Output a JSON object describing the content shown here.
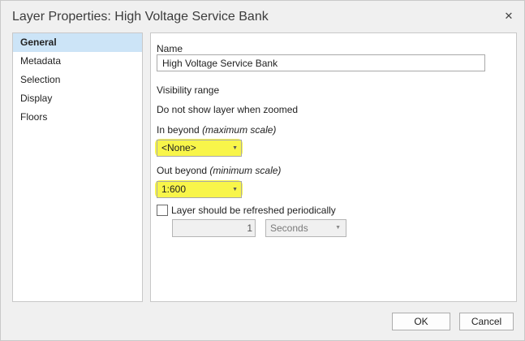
{
  "window": {
    "title": "Layer Properties: High Voltage Service Bank"
  },
  "sidebar": {
    "items": [
      {
        "label": "General",
        "selected": true
      },
      {
        "label": "Metadata",
        "selected": false
      },
      {
        "label": "Selection",
        "selected": false
      },
      {
        "label": "Display",
        "selected": false
      },
      {
        "label": "Floors",
        "selected": false
      }
    ]
  },
  "general": {
    "name_label": "Name",
    "name_value": "High Voltage Service Bank",
    "visibility_label": "Visibility range",
    "dont_show_label": "Do not show layer when zoomed",
    "in_beyond_label": "In beyond",
    "in_beyond_hint": "(maximum scale)",
    "in_beyond_value": "<None>",
    "out_beyond_label": "Out beyond",
    "out_beyond_hint": "(minimum scale)",
    "out_beyond_value": "1:600",
    "refresh_label": "Layer should be refreshed periodically",
    "refresh_checked": false,
    "refresh_interval": "1",
    "refresh_unit": "Seconds"
  },
  "buttons": {
    "ok": "OK",
    "cancel": "Cancel"
  },
  "colors": {
    "highlight": "#f7f32a",
    "selected_bg": "#cce4f7"
  },
  "icons": {
    "close": "close-icon",
    "dropdown": "chevron-down-icon"
  }
}
